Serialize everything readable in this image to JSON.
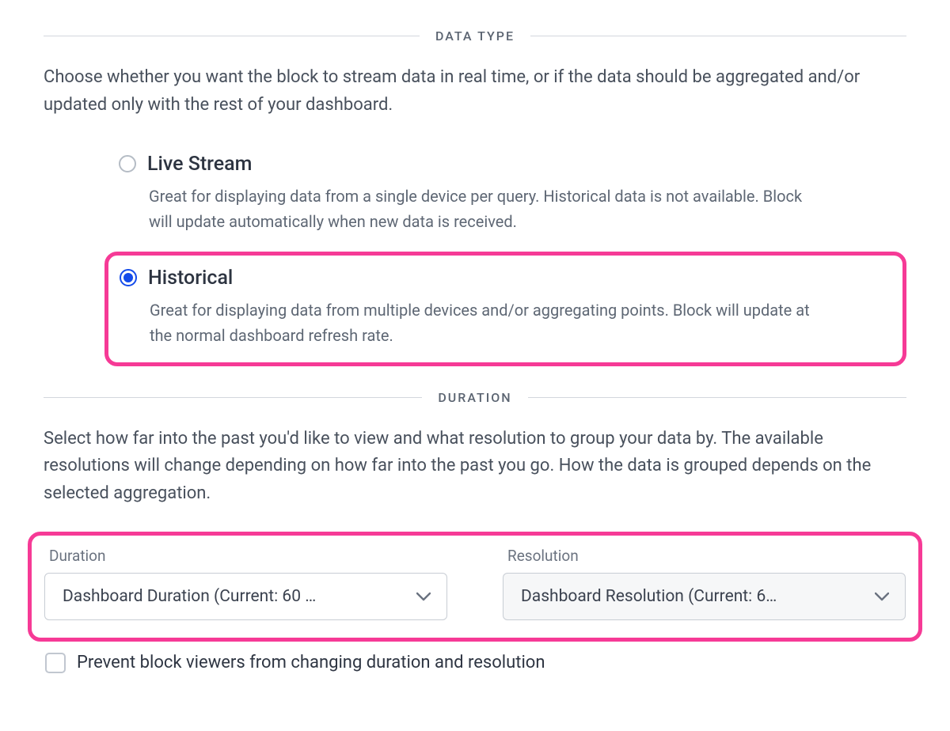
{
  "sections": {
    "dataType": {
      "heading": "DATA TYPE",
      "description": "Choose whether you want the block to stream data in real time, or if the data should be aggregated and/or updated only with the rest of your dashboard.",
      "options": {
        "live": {
          "title": "Live Stream",
          "subtitle": "Great for displaying data from a single device per query. Historical data is not available. Block will update automatically when new data is received.",
          "selected": false
        },
        "historical": {
          "title": "Historical",
          "subtitle": "Great for displaying data from multiple devices and/or aggregating points. Block will update at the normal dashboard refresh rate.",
          "selected": true
        }
      }
    },
    "duration": {
      "heading": "DURATION",
      "description": "Select how far into the past you'd like to view and what resolution to group your data by. The available resolutions will change depending on how far into the past you go. How the data is grouped depends on the selected aggregation.",
      "fields": {
        "duration": {
          "label": "Duration",
          "value": "Dashboard Duration (Current: 60 …"
        },
        "resolution": {
          "label": "Resolution",
          "value": "Dashboard Resolution (Current: 6…"
        }
      },
      "preventChange": {
        "label": "Prevent block viewers from changing duration and resolution",
        "checked": false
      }
    }
  }
}
